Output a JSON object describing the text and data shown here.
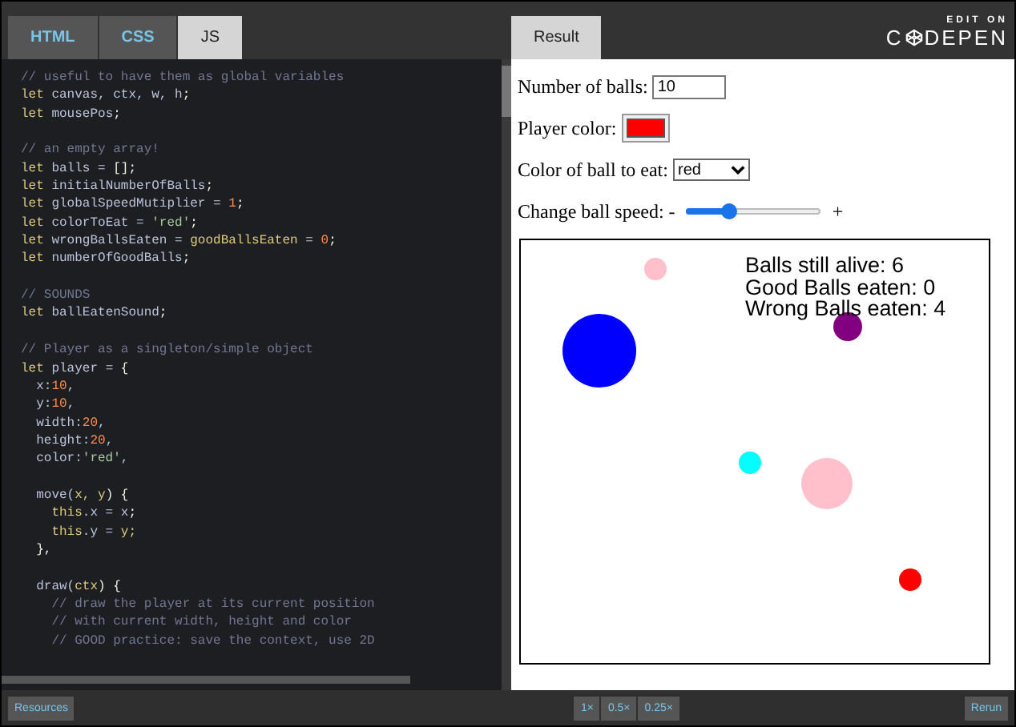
{
  "editor": {
    "tabs": [
      {
        "label": "HTML",
        "selected": false
      },
      {
        "label": "CSS",
        "selected": false
      },
      {
        "label": "JS",
        "selected": true
      }
    ],
    "code_lines": [
      {
        "kind": "code",
        "segments": [
          {
            "text": "// useful to have them as global variables",
            "kind": "comment"
          }
        ]
      },
      {
        "kind": "code",
        "segments": [
          {
            "text": "let",
            "kind": "keyword"
          },
          {
            "text": " canvas, ctx, w, h",
            "kind": "plain"
          },
          {
            "text": ";",
            "kind": "punct"
          }
        ]
      },
      {
        "kind": "code",
        "segments": [
          {
            "text": "let",
            "kind": "keyword"
          },
          {
            "text": " mousePos",
            "kind": "plain"
          },
          {
            "text": ";",
            "kind": "punct"
          }
        ]
      },
      {
        "kind": "blank"
      },
      {
        "kind": "code",
        "segments": [
          {
            "text": "// an empty array!",
            "kind": "comment"
          }
        ]
      },
      {
        "kind": "code",
        "segments": [
          {
            "text": "let",
            "kind": "keyword"
          },
          {
            "text": " balls = ",
            "kind": "plain"
          },
          {
            "text": "[];",
            "kind": "punct"
          }
        ]
      },
      {
        "kind": "code",
        "segments": [
          {
            "text": "let",
            "kind": "keyword"
          },
          {
            "text": " initialNumberOfBalls",
            "kind": "plain"
          },
          {
            "text": ";",
            "kind": "punct"
          }
        ]
      },
      {
        "kind": "code",
        "segments": [
          {
            "text": "let",
            "kind": "keyword"
          },
          {
            "text": " globalSpeedMutiplier = ",
            "kind": "plain"
          },
          {
            "text": "1",
            "kind": "number"
          },
          {
            "text": ";",
            "kind": "punct"
          }
        ]
      },
      {
        "kind": "code",
        "segments": [
          {
            "text": "let",
            "kind": "keyword"
          },
          {
            "text": " colorToEat = ",
            "kind": "plain"
          },
          {
            "text": "'red'",
            "kind": "string"
          },
          {
            "text": ";",
            "kind": "punct"
          }
        ]
      },
      {
        "kind": "code",
        "segments": [
          {
            "text": "let",
            "kind": "keyword"
          },
          {
            "text": " wrongBallsEaten = ",
            "kind": "plain"
          },
          {
            "text": "goodBallsEaten",
            "kind": "keyword"
          },
          {
            "text": " = ",
            "kind": "plain"
          },
          {
            "text": "0",
            "kind": "number"
          },
          {
            "text": ";",
            "kind": "punct"
          }
        ]
      },
      {
        "kind": "code",
        "segments": [
          {
            "text": "let",
            "kind": "keyword"
          },
          {
            "text": " numberOfGoodBalls",
            "kind": "plain"
          },
          {
            "text": ";",
            "kind": "punct"
          }
        ]
      },
      {
        "kind": "blank"
      },
      {
        "kind": "code",
        "segments": [
          {
            "text": "// SOUNDS",
            "kind": "comment"
          }
        ]
      },
      {
        "kind": "code",
        "segments": [
          {
            "text": "let",
            "kind": "keyword"
          },
          {
            "text": " ballEatenSound",
            "kind": "plain"
          },
          {
            "text": ";",
            "kind": "punct"
          }
        ]
      },
      {
        "kind": "blank"
      },
      {
        "kind": "code",
        "segments": [
          {
            "text": "// Player as a singleton/simple object",
            "kind": "comment"
          }
        ]
      },
      {
        "kind": "code",
        "segments": [
          {
            "text": "let",
            "kind": "keyword"
          },
          {
            "text": " player = ",
            "kind": "plain"
          },
          {
            "text": "{",
            "kind": "punct"
          }
        ]
      },
      {
        "kind": "code",
        "segments": [
          {
            "text": "  x:",
            "kind": "plain"
          },
          {
            "text": "10",
            "kind": "number"
          },
          {
            "text": ",",
            "kind": "plain"
          }
        ]
      },
      {
        "kind": "code",
        "segments": [
          {
            "text": "  y:",
            "kind": "plain"
          },
          {
            "text": "10",
            "kind": "number"
          },
          {
            "text": ",",
            "kind": "plain"
          }
        ]
      },
      {
        "kind": "code",
        "segments": [
          {
            "text": "  width:",
            "kind": "plain"
          },
          {
            "text": "20",
            "kind": "number"
          },
          {
            "text": ",",
            "kind": "plain"
          }
        ]
      },
      {
        "kind": "code",
        "segments": [
          {
            "text": "  height:",
            "kind": "plain"
          },
          {
            "text": "20",
            "kind": "number"
          },
          {
            "text": ",",
            "kind": "plain"
          }
        ]
      },
      {
        "kind": "code",
        "segments": [
          {
            "text": "  color:",
            "kind": "plain"
          },
          {
            "text": "'red'",
            "kind": "string"
          },
          {
            "text": ",",
            "kind": "plain"
          }
        ]
      },
      {
        "kind": "blank"
      },
      {
        "kind": "code",
        "segments": [
          {
            "text": "  move(",
            "kind": "plain"
          },
          {
            "text": "x, y",
            "kind": "keyword"
          },
          {
            "text": ") {",
            "kind": "punct"
          }
        ]
      },
      {
        "kind": "code",
        "segments": [
          {
            "text": "    this",
            "kind": "keyword"
          },
          {
            "text": ".x = x",
            "kind": "plain"
          },
          {
            "text": ";",
            "kind": "punct"
          }
        ]
      },
      {
        "kind": "code",
        "segments": [
          {
            "text": "    this",
            "kind": "keyword"
          },
          {
            "text": ".y = ",
            "kind": "plain"
          },
          {
            "text": "y;",
            "kind": "keyword"
          }
        ]
      },
      {
        "kind": "code",
        "segments": [
          {
            "text": "  },",
            "kind": "punct"
          }
        ]
      },
      {
        "kind": "blank"
      },
      {
        "kind": "code",
        "segments": [
          {
            "text": "  draw(",
            "kind": "plain"
          },
          {
            "text": "ctx",
            "kind": "keyword"
          },
          {
            "text": ") {",
            "kind": "punct"
          }
        ]
      },
      {
        "kind": "code",
        "segments": [
          {
            "text": "    // draw the player at its current position",
            "kind": "comment"
          }
        ]
      },
      {
        "kind": "code",
        "segments": [
          {
            "text": "    // with current width, height and color",
            "kind": "comment"
          }
        ]
      },
      {
        "kind": "code",
        "segments": [
          {
            "text": "    // GOOD practice: save the context, use 2D",
            "kind": "comment"
          }
        ]
      }
    ]
  },
  "result": {
    "tab": "Result",
    "logo": {
      "top": "EDIT ON",
      "prefix": "C",
      "suffix": "DEPEN"
    },
    "controls": [
      {
        "kind": "number",
        "label": "Number of balls:",
        "value": "10"
      },
      {
        "kind": "color",
        "label": "Player color:",
        "color": "#ff0000"
      },
      {
        "kind": "select",
        "label": "Color of ball to eat:",
        "value": "red"
      },
      {
        "kind": "slider",
        "label": "Change ball speed: -",
        "after": "+",
        "level": 0.32
      }
    ],
    "canvas": {
      "stats": [
        "Balls still alive: 6",
        "Good Balls eaten: 0",
        "Wrong Balls eaten: 4"
      ],
      "balls": [
        {
          "color": "#ffc0cb"
        },
        {
          "color": "#0000ff"
        },
        {
          "color": "#800080"
        },
        {
          "color": "#00ffff"
        },
        {
          "color": "#ffc0cb"
        },
        {
          "color": "#ff0000"
        }
      ]
    }
  },
  "footer": {
    "resources": "Resources",
    "zoom_buttons": [
      "1×",
      "0.5×",
      "0.25×"
    ],
    "rerun": "Rerun"
  }
}
